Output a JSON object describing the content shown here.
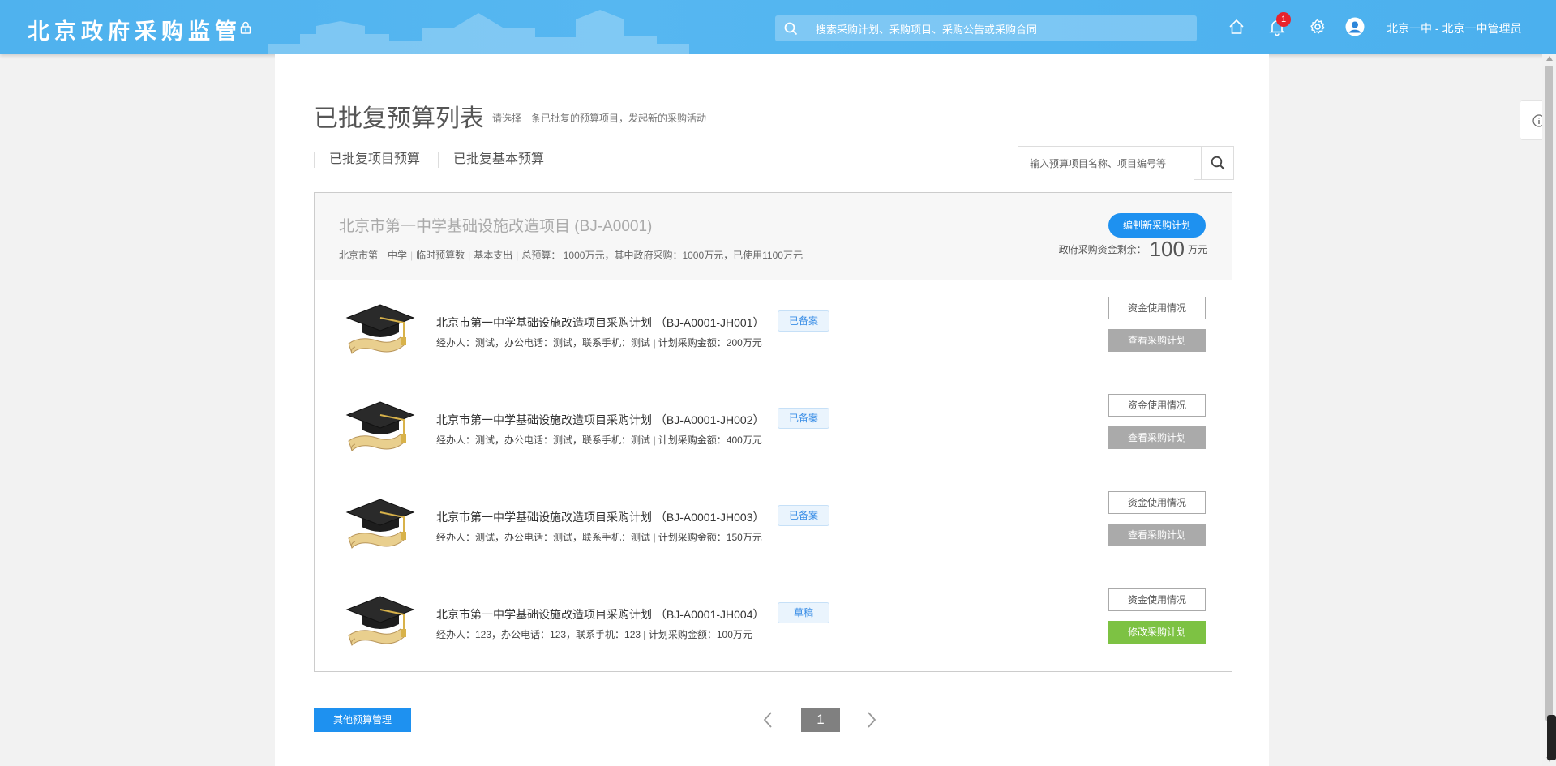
{
  "header": {
    "logo": "北京政府采购监管",
    "search_placeholder": "搜索采购计划、采购项目、采购公告或采购合同",
    "notification_count": "1",
    "user": "北京一中 - 北京一中管理员",
    "icons": [
      "lock-icon",
      "search-icon",
      "home-icon",
      "bell-icon",
      "gear-icon",
      "user-avatar-icon"
    ]
  },
  "page": {
    "title": "已批复预算列表",
    "hint": "请选择一条已批复的预算项目，发起新的采购活动",
    "tabs": [
      "已批复项目预算",
      "已批复基本预算"
    ],
    "search_placeholder": "输入预算项目名称、项目编号等"
  },
  "project": {
    "title": "北京市第一中学基础设施改造项目 (BJ-A0001)",
    "meta": [
      "北京市第一中学",
      "临时预算数",
      "基本支出",
      "总预算： 1000万元，其中政府采购：1000万元，已使用1100万元"
    ],
    "new_plan_label": "编制新采购计划",
    "remain_label": "政府采购资金剩余：",
    "remain_value": "100",
    "remain_unit": "万元"
  },
  "plans": [
    {
      "title": "北京市第一中学基础设施改造项目采购计划 （BJ-A0001-JH001）",
      "info": "经办人：测试，办公电话：测试，联系手机：测试 | 计划采购金额：200万元",
      "status": "已备案",
      "fund_label": "资金使用情况",
      "action_label": "查看采购计划"
    },
    {
      "title": "北京市第一中学基础设施改造项目采购计划 （BJ-A0001-JH002）",
      "info": "经办人：测试，办公电话：测试，联系手机：测试 | 计划采购金额：400万元",
      "status": "已备案",
      "fund_label": "资金使用情况",
      "action_label": "查看采购计划"
    },
    {
      "title": "北京市第一中学基础设施改造项目采购计划 （BJ-A0001-JH003）",
      "info": "经办人：测试，办公电话：测试，联系手机：测试 | 计划采购金额：150万元",
      "status": "已备案",
      "fund_label": "资金使用情况",
      "action_label": "查看采购计划"
    },
    {
      "title": "北京市第一中学基础设施改造项目采购计划 （BJ-A0001-JH004）",
      "info": "经办人：123，办公电话：123，联系手机：123 | 计划采购金额：100万元",
      "status": "草稿",
      "fund_label": "资金使用情况",
      "action_label": "修改采购计划"
    }
  ],
  "footer": {
    "other_budget_label": "其他预算管理",
    "page_current": "1"
  },
  "colors": {
    "header_bg": "#4fb2ee",
    "primary": "#1e91f0",
    "success": "#7dc243",
    "muted_button": "#aaaaaa",
    "badge": "#e8232d"
  }
}
